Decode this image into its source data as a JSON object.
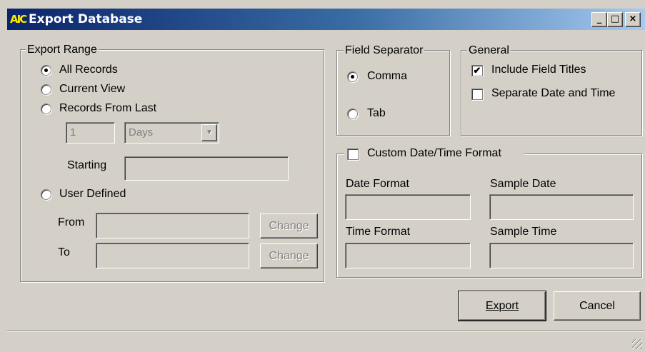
{
  "window": {
    "title": "Export Database",
    "icon_text": "AIC",
    "controls": {
      "minimize": "_",
      "maximize": "□",
      "close": "×"
    }
  },
  "export_range": {
    "legend": "Export Range",
    "options": {
      "all_records": {
        "label": "All Records",
        "selected": true
      },
      "current_view": {
        "label": "Current View",
        "selected": false
      },
      "records_from_last": {
        "label": "Records From Last",
        "selected": false
      },
      "user_defined": {
        "label": "User Defined",
        "selected": false
      }
    },
    "last_count": "1",
    "last_unit": "Days",
    "starting_label": "Starting",
    "starting_value": "",
    "from_label": "From",
    "from_value": "",
    "to_label": "To",
    "to_value": "",
    "change_label": "Change"
  },
  "field_separator": {
    "legend": "Field Separator",
    "comma": {
      "label": "Comma",
      "selected": true
    },
    "tab": {
      "label": "Tab",
      "selected": false
    }
  },
  "general": {
    "legend": "General",
    "include_field_titles": {
      "label": "Include Field Titles",
      "checked": true
    },
    "separate_date_time": {
      "label": "Separate Date and Time",
      "checked": false
    }
  },
  "custom_format": {
    "legend": "Custom Date/Time Format",
    "checked": false,
    "date_format_label": "Date Format",
    "date_format_value": "",
    "sample_date_label": "Sample Date",
    "sample_date_value": "",
    "time_format_label": "Time Format",
    "time_format_value": "",
    "sample_time_label": "Sample Time",
    "sample_time_value": ""
  },
  "buttons": {
    "export": "Export",
    "cancel": "Cancel"
  },
  "icons": {
    "check_mark": "✔",
    "dropdown_arrow": "▼"
  }
}
